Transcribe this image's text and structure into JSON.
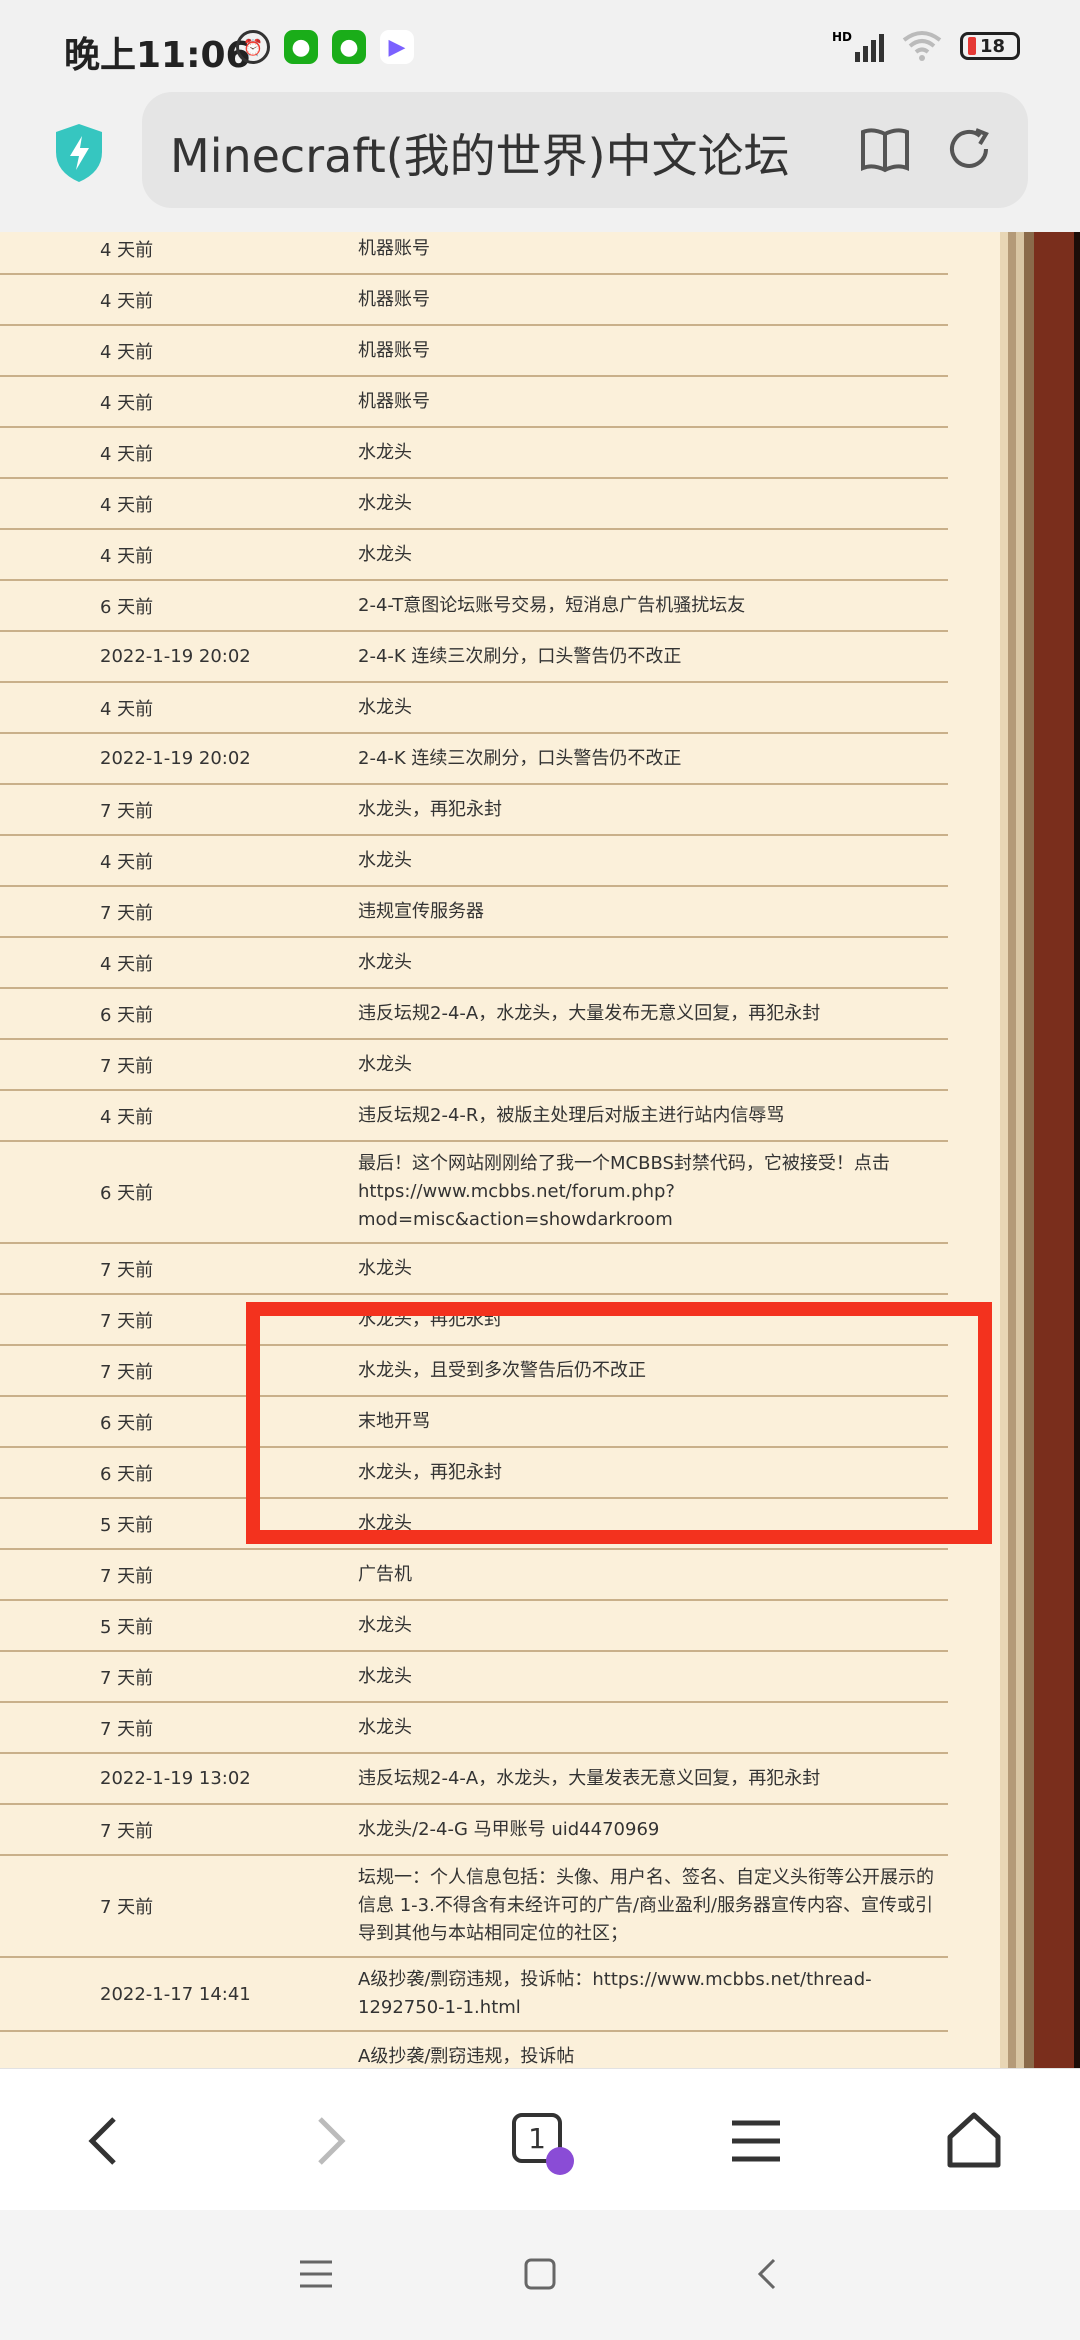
{
  "status_bar": {
    "time": "晚上11:06",
    "battery": "18",
    "network": "HD"
  },
  "browser": {
    "url_title": "Minecraft(我的世界)中文论坛"
  },
  "rows": [
    {
      "time": "4 天前",
      "reason": "机器账号"
    },
    {
      "time": "4 天前",
      "reason": "机器账号"
    },
    {
      "time": "4 天前",
      "reason": "机器账号"
    },
    {
      "time": "4 天前",
      "reason": "机器账号"
    },
    {
      "time": "4 天前",
      "reason": "水龙头"
    },
    {
      "time": "4 天前",
      "reason": "水龙头"
    },
    {
      "time": "4 天前",
      "reason": "水龙头"
    },
    {
      "time": "6 天前",
      "reason": "2-4-T意图论坛账号交易，短消息广告机骚扰坛友"
    },
    {
      "time": "2022-1-19 20:02",
      "reason": "2-4-K 连续三次刷分，口头警告仍不改正"
    },
    {
      "time": "4 天前",
      "reason": "水龙头"
    },
    {
      "time": "2022-1-19 20:02",
      "reason": "2-4-K 连续三次刷分，口头警告仍不改正"
    },
    {
      "time": "7 天前",
      "reason": "水龙头，再犯永封"
    },
    {
      "time": "4 天前",
      "reason": "水龙头"
    },
    {
      "time": "7 天前",
      "reason": "违规宣传服务器"
    },
    {
      "time": "4 天前",
      "reason": "水龙头"
    },
    {
      "time": "6 天前",
      "reason": "违反坛规2-4-A，水龙头，大量发布无意义回复，再犯永封"
    },
    {
      "time": "7 天前",
      "reason": "水龙头"
    },
    {
      "time": "4 天前",
      "reason": "违反坛规2-4-R，被版主处理后对版主进行站内信辱骂"
    },
    {
      "time": "6 天前",
      "reason": "最后！这个网站刚刚给了我一个MCBBS封禁代码，它被接受！点击 https://www.mcbbs.net/forum.php?mod=misc&action=showdarkroom"
    },
    {
      "time": "7 天前",
      "reason": "水龙头"
    },
    {
      "time": "7 天前",
      "reason": "水龙头，再犯永封"
    },
    {
      "time": "7 天前",
      "reason": "水龙头，且受到多次警告后仍不改正"
    },
    {
      "time": "6 天前",
      "reason": "末地开骂"
    },
    {
      "time": "6 天前",
      "reason": "水龙头，再犯永封"
    },
    {
      "time": "5 天前",
      "reason": "水龙头"
    },
    {
      "time": "7 天前",
      "reason": "广告机"
    },
    {
      "time": "5 天前",
      "reason": "水龙头"
    },
    {
      "time": "7 天前",
      "reason": "水龙头"
    },
    {
      "time": "7 天前",
      "reason": "水龙头"
    },
    {
      "time": "2022-1-19 13:02",
      "reason": "违反坛规2-4-A，水龙头，大量发表无意义回复，再犯永封"
    },
    {
      "time": "7 天前",
      "reason": "水龙头/2-4-G 马甲账号 uid4470969"
    },
    {
      "time": "7 天前",
      "reason": "坛规一：个人信息包括：头像、用户名、签名、自定义头衔等公开展示的信息 1-3.不得含有未经许可的广告/商业盈利/服务器宣传内容、宣传或引导到其他与本站相同定位的社区；"
    },
    {
      "time": "2022-1-17 14:41",
      "reason": "A级抄袭/剽窃违规，投诉帖：https://www.mcbbs.net/thread-1292750-1-1.html"
    },
    {
      "time": "",
      "reason": "A级抄袭/剽窃违规，投诉帖"
    }
  ],
  "bottom_nav": {
    "tab_count": "1"
  },
  "colors": {
    "accent_red": "#f3321e",
    "page_bg": "#fbf0da",
    "row_border": "#c9b08a",
    "shield": "#36c6c0"
  }
}
